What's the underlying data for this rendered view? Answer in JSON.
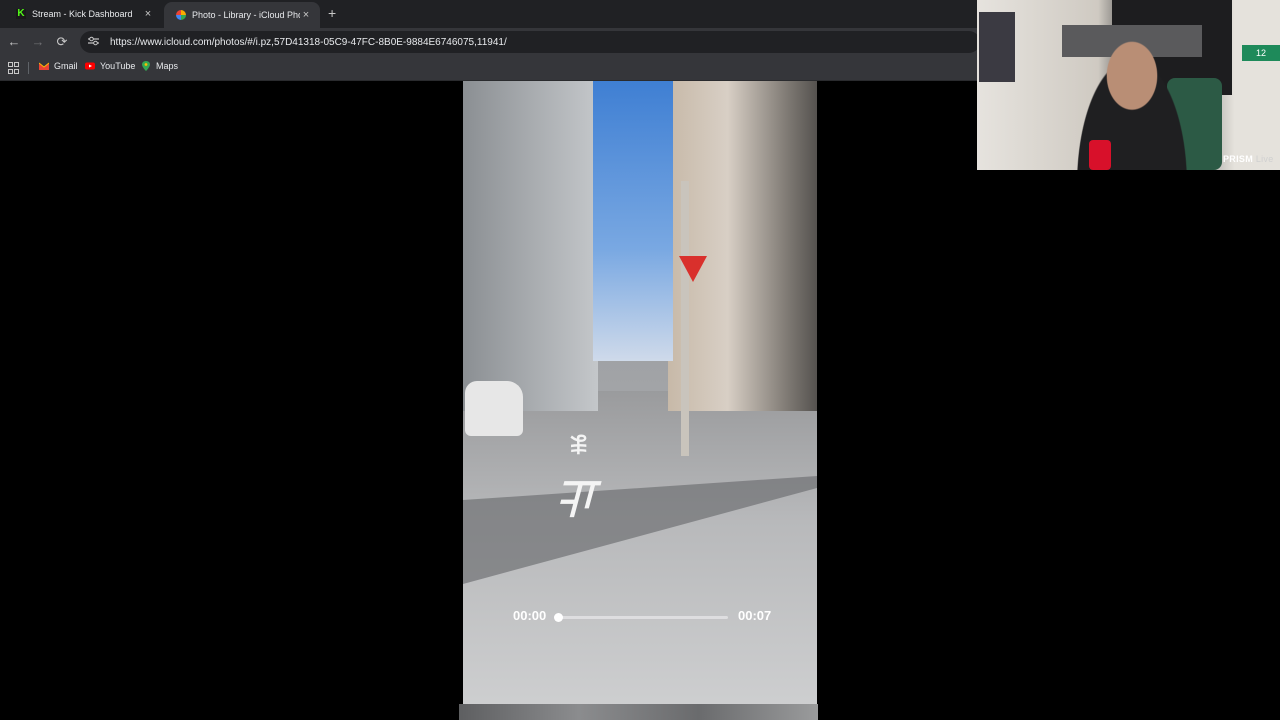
{
  "browser": {
    "tabs": [
      {
        "title": "Stream - Kick Dashboard",
        "favicon": "kick-icon",
        "active": false
      },
      {
        "title": "Photo - Library - iCloud Photos",
        "favicon": "photos-icon",
        "active": true
      }
    ],
    "close_glyph": "×",
    "new_tab_glyph": "+",
    "nav": {
      "back": "←",
      "forward": "→",
      "reload": "⟳"
    },
    "url": "https://www.icloud.com/photos/#/i.pz,57D41318-05C9-47FC-8B0E-9884E6746075,11941/",
    "bookmarks": [
      {
        "label": "Gmail",
        "icon": "gmail-icon",
        "color": "#ea4335"
      },
      {
        "label": "YouTube",
        "icon": "youtube-icon",
        "color": "#ff0000"
      },
      {
        "label": "Maps",
        "icon": "maps-icon",
        "color": "#34a853"
      }
    ]
  },
  "video": {
    "current_time": "00:00",
    "duration": "00:07",
    "progress_fraction": 0.0
  },
  "webcam": {
    "brand": "PRISM",
    "brand_suffix": "Live",
    "sign_text": "12"
  },
  "colors": {
    "tab_bar": "#202124",
    "toolbar": "#35363a",
    "kick_green": "#53fc18"
  }
}
